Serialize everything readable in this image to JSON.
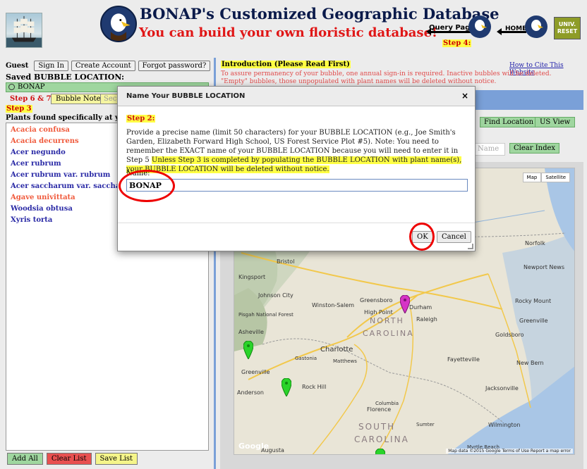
{
  "header": {
    "title": "BONAP's Customized Geographic Database",
    "subtitle": "You can build your own floristic database!",
    "query_page_label": "Query Page",
    "home_label": "HOME",
    "univ_reset_label": "UNIV. RESET",
    "step4": "Step 4:"
  },
  "auth": {
    "guest": "Guest",
    "sign_in": "Sign In",
    "create_account": "Create Account",
    "forgot_password": "Forgot password?"
  },
  "left": {
    "saved_label": "Saved BUBBLE LOCATION:",
    "saved_value": "BONAP",
    "step67": "Step 6 & 7=",
    "bubble_note": "Bubble Note",
    "sec_btn": "Sec",
    "step3": "Step 3",
    "plants_label": "Plants found specifically at your bu",
    "plants": [
      {
        "name": "Acacia confusa",
        "color": "#f05a3c"
      },
      {
        "name": "Acacia decurrens",
        "color": "#f05a3c"
      },
      {
        "name": "Acer negundo",
        "color": "#2a2aa6"
      },
      {
        "name": "Acer rubrum",
        "color": "#2a2aa6"
      },
      {
        "name": "Acer rubrum var. rubrum",
        "color": "#2a2aa6"
      },
      {
        "name": "Acer saccharum var. saccharum",
        "color": "#2a2aa6"
      },
      {
        "name": "Agave univittata",
        "color": "#f05a3c"
      },
      {
        "name": "Woodsia obtusa",
        "color": "#2a2aa6"
      },
      {
        "name": "Xyris torta",
        "color": "#2a2aa6"
      }
    ],
    "add_all": "Add All",
    "clear_list": "Clear List",
    "save_list": "Save List"
  },
  "right": {
    "intro_title": "Introduction (Please Read First)",
    "cite_link": "How to Cite This Website",
    "intro_text": "To assure permanency of your bubble, one annual sign-in is required. Inactive bubbles will be deleted. \"Empty\" bubbles, those unpopulated with plant names will be deleted without notice.",
    "find_location": "Find Location",
    "us_view": "US View",
    "name_ghost": "Name",
    "clear_index": "Clear Index"
  },
  "map": {
    "map_btn": "Map",
    "satellite_btn": "Satellite",
    "footer": "Map data ©2015 Google   Terms of Use   Report a map error",
    "google": "Google",
    "labels": [
      {
        "text": "Kingsport",
        "size": 8
      },
      {
        "text": "Bristol",
        "size": 8
      },
      {
        "text": "Johnson City",
        "size": 8
      },
      {
        "text": "Winston-Salem",
        "size": 8
      },
      {
        "text": "Greensboro",
        "size": 8
      },
      {
        "text": "Durham",
        "size": 8
      },
      {
        "text": "High Point",
        "size": 8
      },
      {
        "text": "Raleigh",
        "size": 8
      },
      {
        "text": "Asheville",
        "size": 8
      },
      {
        "text": "Charlotte",
        "size": 10
      },
      {
        "text": "Greenville",
        "size": 8
      },
      {
        "text": "Fayetteville",
        "size": 8
      },
      {
        "text": "Anderson",
        "size": 8
      },
      {
        "text": "Augusta",
        "size": 8
      },
      {
        "text": "Florence",
        "size": 8
      },
      {
        "text": "NORTH",
        "size": 11
      },
      {
        "text": "CAROLINA",
        "size": 11
      },
      {
        "text": "SOUTH",
        "size": 12
      },
      {
        "text": "CAROLINA",
        "size": 12
      },
      {
        "text": "New Bern",
        "size": 8
      },
      {
        "text": "Jacksonville",
        "size": 8
      },
      {
        "text": "Goldsboro",
        "size": 8
      },
      {
        "text": "Greenville",
        "size": 8
      },
      {
        "text": "Rocky Mount",
        "size": 8
      },
      {
        "text": "Newport News",
        "size": 8
      },
      {
        "text": "Norfolk",
        "size": 8
      },
      {
        "text": "Wilmington",
        "size": 8
      },
      {
        "text": "Rock Hill",
        "size": 8
      },
      {
        "text": "Matthews",
        "size": 7
      },
      {
        "text": "Gastonia",
        "size": 7
      },
      {
        "text": "Sumter",
        "size": 7
      },
      {
        "text": "Columbia",
        "size": 7
      },
      {
        "text": "Myrtle Beach",
        "size": 7
      },
      {
        "text": "Pisgah National Forest",
        "size": 7
      }
    ]
  },
  "modal": {
    "title": "Name Your BUBBLE LOCATION",
    "close": "×",
    "step": "Step 2:",
    "text_normal": "Provide a precise name (limit 50 characters) for your BUBBLE LOCATION (e.g., Joe Smith's Garden, Elizabeth Forward High School, US Forest Service Plot #5). Note: You need to remember the EXACT name of your BUBBLE LOCATION because you will need to enter it in Step 5",
    "text_highlight": "Unless Step 3 is completed by populating the BUBBLE LOCATION with plant name(s), your BUBBLE LOCATION will be deleted without notice.",
    "name_label": "Name:",
    "name_value": "BONAP",
    "ok": "OK",
    "cancel": "Cancel"
  },
  "colors": {
    "accent_blue": "#7aa0d8",
    "green_button": "#9fd69f",
    "highlight_yellow": "#ffff44",
    "red_title": "#e01616",
    "annotation_red": "#ee0000"
  }
}
